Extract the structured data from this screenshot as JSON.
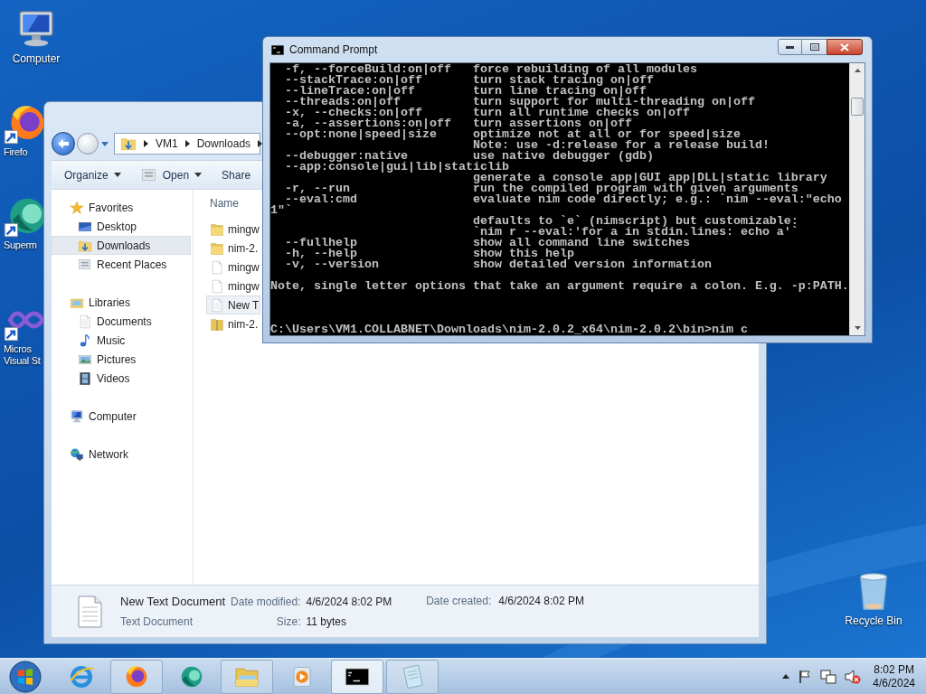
{
  "desktop_icons": [
    {
      "label_lines": [
        "Computer"
      ],
      "kind": "computer",
      "shortcut": false
    },
    {
      "label_lines": [
        "Firefo"
      ],
      "kind": "firefox",
      "shortcut": true
    },
    {
      "label_lines": [
        "Superm"
      ],
      "kind": "supermium",
      "shortcut": true
    },
    {
      "label_lines": [
        "Micros",
        "Visual St"
      ],
      "kind": "visual_studio",
      "shortcut": true
    },
    {
      "label_lines": [
        "Recycle Bin"
      ],
      "kind": "recycle_bin",
      "shortcut": false
    }
  ],
  "explorer": {
    "breadcrumb": [
      "VM1",
      "Downloads"
    ],
    "toolbar": [
      {
        "label": "Organize",
        "kind": "menu"
      },
      {
        "label": "Open",
        "kind": "icon_menu"
      },
      {
        "label": "Share",
        "kind": "plain"
      }
    ],
    "navigation": [
      {
        "label": "Favorites",
        "kind": "favorites",
        "selected": false,
        "children": [
          {
            "label": "Desktop",
            "kind": "desktop",
            "selected": false
          },
          {
            "label": "Downloads",
            "kind": "downloads",
            "selected": true
          },
          {
            "label": "Recent Places",
            "kind": "recent",
            "selected": false
          }
        ]
      },
      {
        "label": "Libraries",
        "kind": "libraries",
        "selected": false,
        "children": [
          {
            "label": "Documents",
            "kind": "documents",
            "selected": false
          },
          {
            "label": "Music",
            "kind": "music",
            "selected": false
          },
          {
            "label": "Pictures",
            "kind": "pictures",
            "selected": false
          },
          {
            "label": "Videos",
            "kind": "videos",
            "selected": false
          }
        ]
      },
      {
        "label": "Computer",
        "kind": "computer",
        "selected": false
      },
      {
        "label": "Network",
        "kind": "network",
        "selected": false
      }
    ],
    "column_header": "Name",
    "files": [
      {
        "name": "mingw",
        "kind": "folder",
        "selected": false
      },
      {
        "name": "nim-2.",
        "kind": "folder",
        "selected": false
      },
      {
        "name": "mingw",
        "kind": "file",
        "selected": false
      },
      {
        "name": "mingw",
        "kind": "file",
        "selected": false
      },
      {
        "name": "New T",
        "kind": "text",
        "selected": true
      },
      {
        "name": "nim-2.",
        "kind": "zip",
        "selected": false
      }
    ],
    "details": {
      "name": "New Text Document",
      "type": "Text Document",
      "fields": [
        {
          "label": "Date modified:",
          "value": "4/6/2024 8:02 PM"
        },
        {
          "label": "Size:",
          "value": "11 bytes"
        },
        {
          "label": "Date created:",
          "value": "4/6/2024 8:02 PM"
        }
      ]
    }
  },
  "console": {
    "title": "Command Prompt",
    "blocks": [
      [
        "  -f, --forceBuild:on|off   force rebuilding of all modules",
        "  --stackTrace:on|off       turn stack tracing on|off",
        "  --lineTrace:on|off        turn line tracing on|off",
        "  --threads:on|off          turn support for multi-threading on|off",
        "  -x, --checks:on|off       turn all runtime checks on|off",
        "  -a, --assertions:on|off   turn assertions on|off",
        "  --opt:none|speed|size     optimize not at all or for speed|size",
        "                            Note: use -d:release for a release build!",
        "  --debugger:native         use native debugger (gdb)",
        "  --app:console|gui|lib|staticlib",
        "                            generate a console app|GUI app|DLL|static library",
        "  -r, --run                 run the compiled program with given arguments",
        "  --eval:cmd                evaluate nim code directly; e.g.: `nim --eval:\"echo",
        "1\"`",
        "                            defaults to `e` (nimscript) but customizable:",
        "                            `nim r --eval:'for a in stdin.lines: echo a'`",
        "  --fullhelp                show all command line switches",
        "  -h, --help                show this help",
        "  -v, --version             show detailed version information"
      ],
      [
        "Note, single letter options that take an argument require a colon. E.g. -p:PATH."
      ],
      [
        "C:\\Users\\VM1.COLLABNET\\Downloads\\nim-2.0.2_x64\\nim-2.0.2\\bin>nim c"
      ]
    ]
  },
  "taskbar": {
    "items": [
      {
        "kind": "ie",
        "running": false,
        "active": false
      },
      {
        "kind": "firefox",
        "running": true,
        "active": false
      },
      {
        "kind": "supermium",
        "running": false,
        "active": false
      },
      {
        "kind": "explorer",
        "running": true,
        "active": false
      },
      {
        "kind": "media",
        "running": false,
        "active": false
      },
      {
        "kind": "cmd",
        "running": true,
        "active": true
      },
      {
        "kind": "notepad",
        "running": true,
        "active": false
      }
    ],
    "volume_muted": true,
    "clock": {
      "time": "8:02 PM",
      "date": "4/6/2024"
    }
  }
}
